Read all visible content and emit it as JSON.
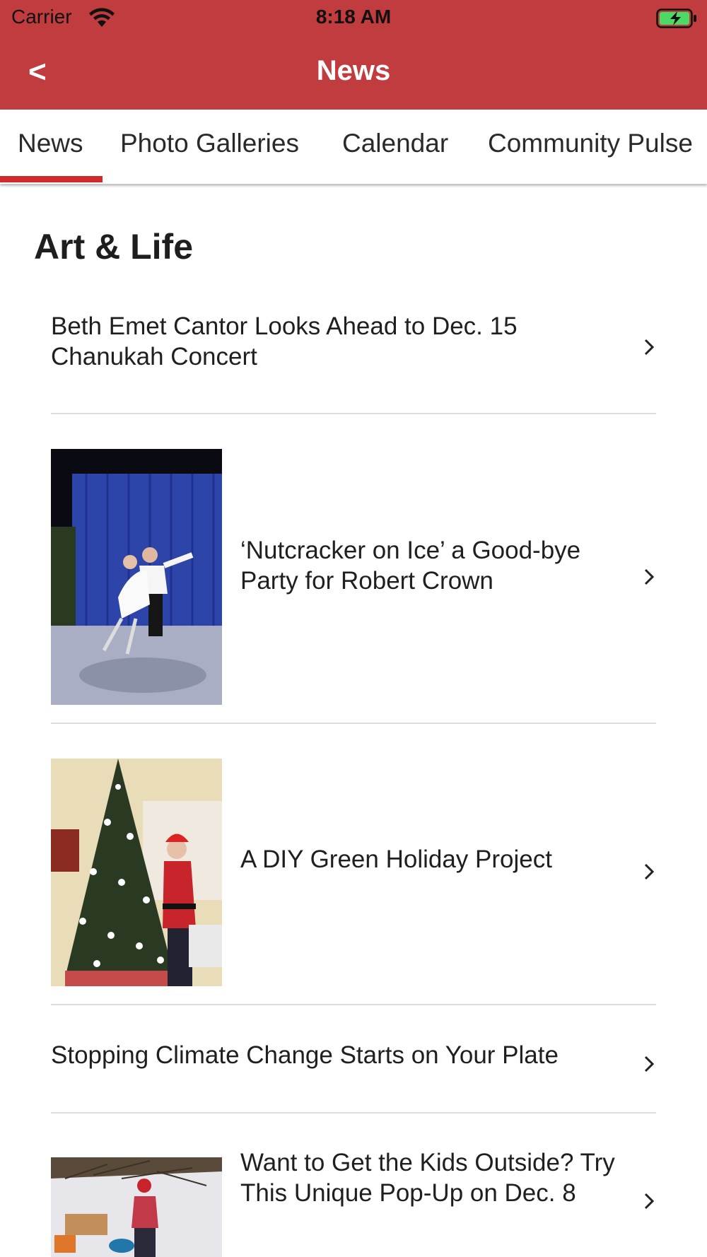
{
  "status_bar": {
    "carrier": "Carrier",
    "time": "8:18 AM",
    "wifi_icon": "wifi-icon",
    "battery_icon": "battery-charging-icon"
  },
  "nav": {
    "back_label": "<",
    "title": "News"
  },
  "tabs": [
    {
      "label": "News",
      "active": true
    },
    {
      "label": "Photo Galleries",
      "active": false
    },
    {
      "label": "Calendar",
      "active": false
    },
    {
      "label": "Community Pulse",
      "active": false
    }
  ],
  "section": {
    "title": "Art & Life"
  },
  "articles": [
    {
      "title": "Beth Emet Cantor Looks Ahead to Dec. 15 Chanukah Concert",
      "has_image": false
    },
    {
      "title": "‘Nutcracker on Ice’ a Good-bye Party for Robert Crown",
      "has_image": true,
      "image": "ice-skaters-photo"
    },
    {
      "title": "A DIY Green Holiday Project",
      "has_image": true,
      "image": "christmas-tree-photo"
    },
    {
      "title": "Stopping Climate Change Starts on Your Plate",
      "has_image": false
    },
    {
      "title": "Want to Get the Kids Outside? Try This Unique Pop-Up on Dec. 8",
      "has_image": true,
      "image": "child-in-snow-photo"
    }
  ],
  "colors": {
    "brand_red": "#c03c3e",
    "tab_indicator": "#d02a2a"
  }
}
